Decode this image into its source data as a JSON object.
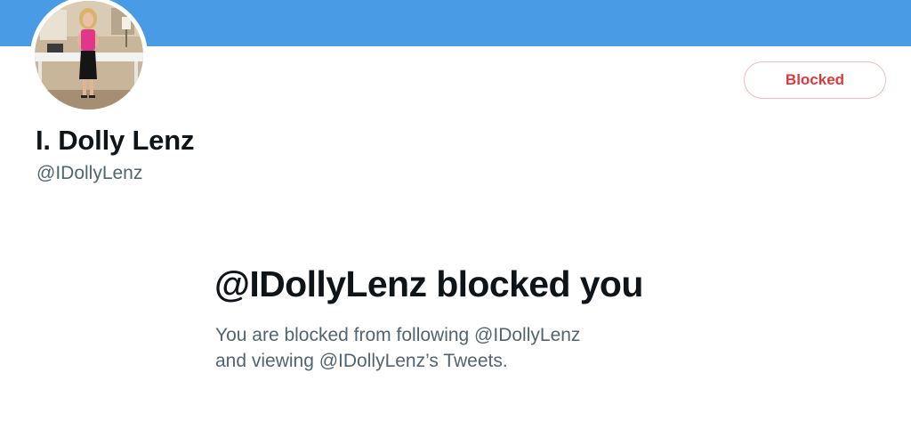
{
  "profile": {
    "display_name": "I. Dolly Lenz",
    "handle": "@IDollyLenz",
    "avatar_alt": "profile photo"
  },
  "actions": {
    "blocked_label": "Blocked"
  },
  "block_notice": {
    "title": "@IDollyLenz blocked you",
    "line1": "You are blocked from following @IDollyLenz",
    "line2": "and viewing @IDollyLenz’s Tweets."
  },
  "colors": {
    "banner": "#4a9be6",
    "blocked_text": "#dc3a3a",
    "blocked_border": "#f4b8bf",
    "primary_text": "#0f1419",
    "secondary_text": "#536471"
  }
}
